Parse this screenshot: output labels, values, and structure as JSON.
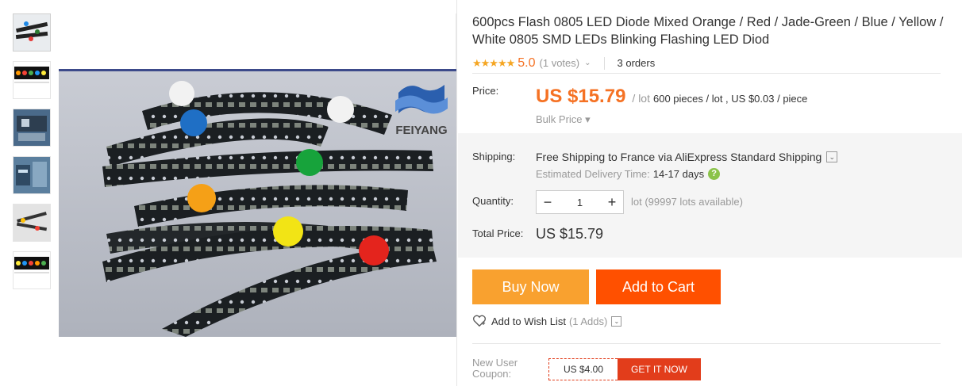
{
  "thumbnails": [
    {
      "name": "thumbnail-1"
    },
    {
      "name": "thumbnail-2"
    },
    {
      "name": "thumbnail-3"
    },
    {
      "name": "thumbnail-4"
    },
    {
      "name": "thumbnail-5"
    },
    {
      "name": "thumbnail-6"
    }
  ],
  "image": {
    "brand": "FEIYANG"
  },
  "product": {
    "title": "600pcs Flash 0805 LED Diode Mixed Orange / Red / Jade-Green / Blue / Yellow / White 0805 SMD LEDs Blinking Flashing LED Diod",
    "stars": "★★★★★",
    "score": "5.0",
    "votes": "(1 votes)",
    "votes_caret": "⌄",
    "orders": "3 orders"
  },
  "price": {
    "label": "Price:",
    "value": "US $15.79",
    "unit": "/ lot",
    "detail": "600 pieces / lot , US $0.03 / piece",
    "bulk": "Bulk Price ▾"
  },
  "shipping": {
    "label": "Shipping:",
    "free": "Free Shipping",
    "rest": "to France via AliExpress Standard Shipping",
    "caret": "⌄",
    "delivery_label": "Estimated Delivery Time:",
    "delivery_days": "14-17 days",
    "help": "?"
  },
  "quantity": {
    "label": "Quantity:",
    "minus": "−",
    "value": "1",
    "plus": "+",
    "available": "lot (99997 lots available)"
  },
  "total": {
    "label": "Total Price:",
    "value": "US $15.79"
  },
  "actions": {
    "buy_now": "Buy Now",
    "add_to_cart": "Add to Cart",
    "wish_label": "Add to Wish List",
    "wish_count": "(1 Adds)",
    "wish_caret": "⌄"
  },
  "coupon": {
    "label": "New User Coupon:",
    "amount": "US $4.00",
    "get": "GET IT NOW"
  },
  "colors": {
    "accent_orange": "#f57224",
    "buy_now": "#f9a12f",
    "add_to_cart": "#ff5000",
    "coupon_red": "#e23d1b"
  }
}
